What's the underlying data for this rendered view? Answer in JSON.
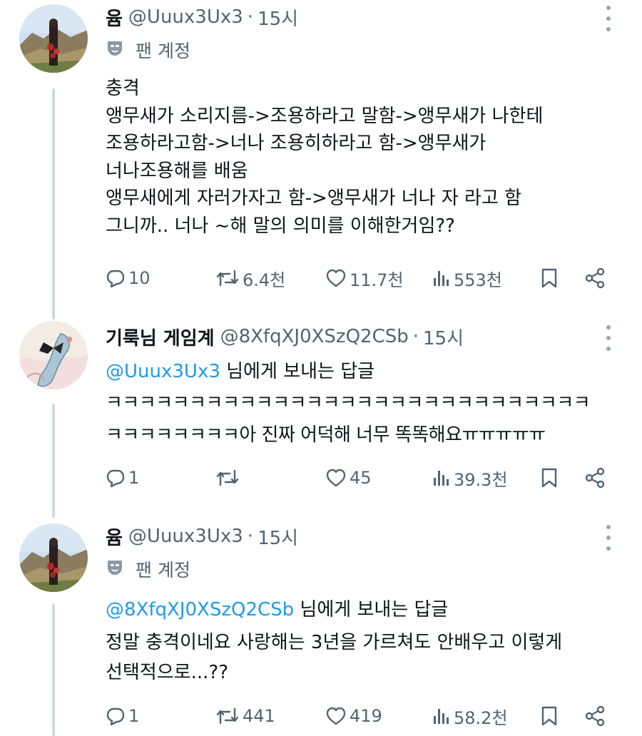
{
  "tweets": [
    {
      "name": "윰",
      "handle": "@Uuux3Ux3",
      "dot": "·",
      "time": "15시",
      "fan_label": "팬 계정",
      "reply_to": null,
      "body": "충격\n앵무새가 소리지름->조용하라고 말함->앵무새가 나한테\n조용하라고함->너나 조용히하라고 함->앵무새가\n너나조용해를 배움\n앵무새에게 자러가자고 함->앵무새가 너나 자 라고 함\n그니까.. 너나 ~해 말의 의미를 이해한거임??",
      "replies": "10",
      "retweets": "6.4천",
      "likes": "11.7천",
      "views": "553천"
    },
    {
      "name": "기룩님 게임계",
      "handle": "@8XfqXJ0XSzQ2CSb",
      "dot": "·",
      "time": "15시",
      "fan_label": null,
      "reply_to": {
        "mention": "@Uuux3Ux3",
        "suffix": " 님에게 보내는 답글"
      },
      "body": "ㅋㅋㅋㅋㅋㅋㅋㅋㅋㅋㅋㅋㅋㅋㅋㅋㅋㅋㅋㅋㅋㅋㅋㅋㅋㅋㅋㅋㅋ\nㅋㅋㅋㅋㅋㅋㅋㅋ아 진짜 어덕해 너무 똑똑해요ㅠㅠㅠㅠㅠ",
      "replies": "1",
      "retweets": "",
      "likes": "45",
      "views": "39.3천"
    },
    {
      "name": "윰",
      "handle": "@Uuux3Ux3",
      "dot": "·",
      "time": "15시",
      "fan_label": "팬 계정",
      "reply_to": {
        "mention": "@8XfqXJ0XSzQ2CSb",
        "suffix": " 님에게 보내는 답글"
      },
      "body": "정말 충격이네요 사랑해는 3년을 가르쳐도 안배우고 이렇게\n선택적으로...??",
      "replies": "1",
      "retweets": "441",
      "likes": "419",
      "views": "58.2천"
    }
  ],
  "icons": {
    "reply": "speech-bubble-icon",
    "retweet": "retweet-arrows-icon",
    "like": "heart-icon",
    "views": "bar-chart-icon",
    "bookmark": "bookmark-icon",
    "share": "share-nodes-icon",
    "fan_badge": "mask-badge-icon",
    "more": "vertical-ellipsis-icon"
  },
  "colors": {
    "text": "#0f1419",
    "secondary": "#536471",
    "link": "#1d9bf0",
    "thread_line": "#cfd9de"
  }
}
